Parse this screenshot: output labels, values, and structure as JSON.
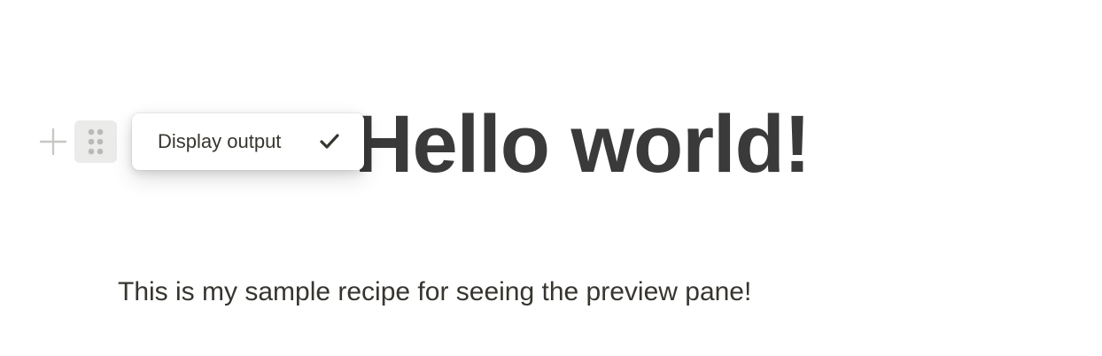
{
  "block_controls": {
    "add_icon": "plus-icon",
    "drag_icon": "drag-handle-icon"
  },
  "popup": {
    "label": "Display output",
    "check_icon": "checkmark-icon",
    "checked": true
  },
  "content": {
    "heading": "Hello world!",
    "paragraph": "This is my sample recipe for seeing the preview pane!"
  },
  "colors": {
    "text": "#37352f",
    "heading": "#3a3a3a",
    "handle_bg": "#ebebea",
    "icon_muted": "#c7c7c5"
  }
}
